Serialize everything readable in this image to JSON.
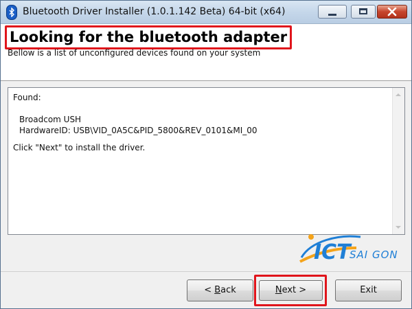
{
  "window": {
    "title": "Bluetooth Driver Installer (1.0.1.142 Beta) 64-bit (x64)",
    "icon": "bluetooth-icon"
  },
  "header": {
    "title": "Looking for the bluetooth adapter",
    "subtitle": "Bellow is a list of unconfigured devices found on your system"
  },
  "panel": {
    "found_label": "Found:",
    "device_name": "Broadcom USH",
    "hardware_id": "HardwareID: USB\\VID_0A5C&PID_5800&REV_0101&MI_00",
    "instruction": "Click \"Next\" to install the driver."
  },
  "watermark": {
    "brand_main": "ICT",
    "brand_sub": "SAI GON"
  },
  "buttons": {
    "back_prefix": "< ",
    "back_mnemonic": "B",
    "back_rest": "ack",
    "next_mnemonic": "N",
    "next_rest": "ext >",
    "exit": "Exit"
  },
  "colors": {
    "highlight": "#e0141b",
    "logo_blue": "#1f7fd6",
    "logo_orange": "#f4a31a"
  }
}
